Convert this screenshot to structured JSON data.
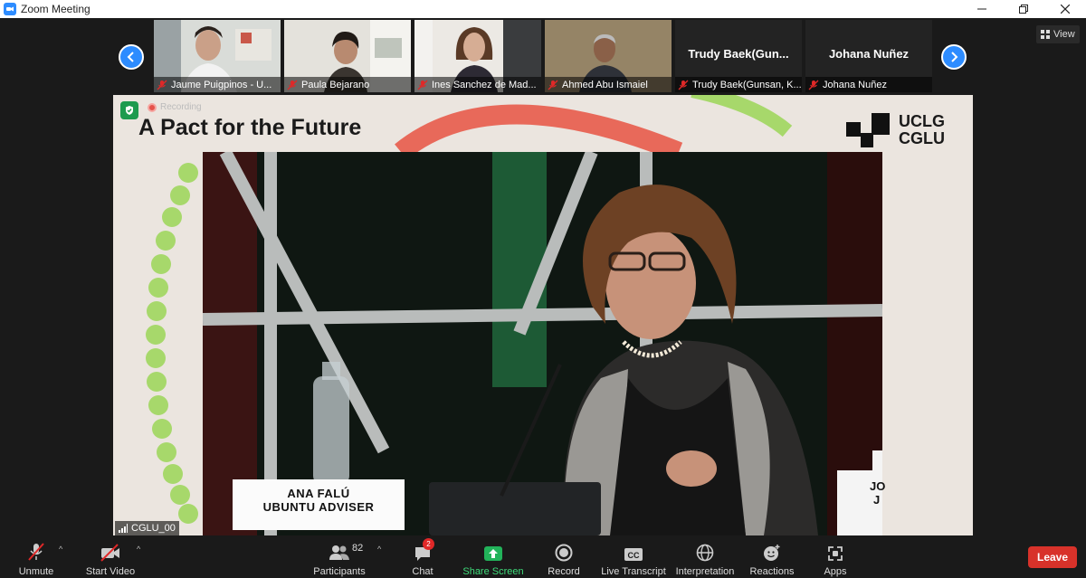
{
  "window": {
    "title": "Zoom Meeting",
    "controls": [
      "minimize",
      "restore",
      "close"
    ]
  },
  "gallery": {
    "participants": [
      {
        "name": "Jaume Puigpinos - U...",
        "has_video": true
      },
      {
        "name": "Paula Bejarano",
        "has_video": true
      },
      {
        "name": "Ines Sanchez de Mad...",
        "has_video": true
      },
      {
        "name": "Ahmed Abu Ismaiel",
        "has_video": true
      },
      {
        "name": "Trudy Baek(Gunsan, K...",
        "display_name": "Trudy  Baek(Gun...",
        "has_video": false
      },
      {
        "name": "Johana Nuñez",
        "display_name": "Johana Nuñez",
        "has_video": false
      }
    ],
    "prev_icon": "chevron-left-icon",
    "next_icon": "chevron-right-icon"
  },
  "view_button": {
    "label": "View",
    "icon": "grid-icon"
  },
  "shared_screen": {
    "recording_label": "Recording",
    "slide_title": "A Pact for the Future",
    "logo_text_top": "UCLG",
    "logo_text_bottom": "CGLU",
    "nameplate_name": "ANA FALÚ",
    "nameplate_role": "UBUNTU ADVISER",
    "right_nameplate_partial": "JO",
    "right_nameplate_partial2": "J",
    "host_label": "CGLU_00"
  },
  "toolbar": {
    "unmute": "Unmute",
    "start_video": "Start Video",
    "participants": "Participants",
    "participants_count": "82",
    "chat": "Chat",
    "chat_badge": "2",
    "share_screen": "Share Screen",
    "record": "Record",
    "live_transcript": "Live Transcript",
    "interpretation": "Interpretation",
    "reactions": "Reactions",
    "apps": "Apps",
    "leave": "Leave"
  },
  "colors": {
    "accent": "#2d8cff",
    "share_green": "#1e9b4f",
    "leave_red": "#d8322a",
    "slide_bg": "#ebe5df",
    "arc_red": "#e8695a",
    "arc_green": "#a7d86b"
  }
}
